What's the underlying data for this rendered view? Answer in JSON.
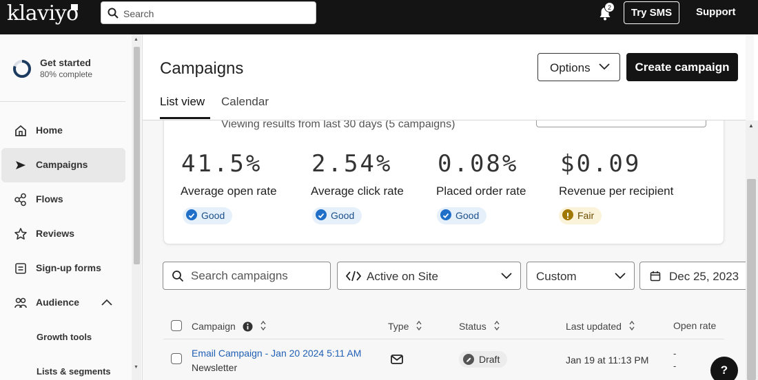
{
  "app": {
    "logo": "klaviyo"
  },
  "topbar": {
    "search_placeholder": "Search",
    "notification_count": "2",
    "try_sms": "Try SMS",
    "support": "Support"
  },
  "sidebar": {
    "get_started": {
      "title": "Get started",
      "progress_label": "80% complete",
      "progress": 0.8
    },
    "items": [
      {
        "label": "Home",
        "icon": "home-icon"
      },
      {
        "label": "Campaigns",
        "icon": "campaigns-icon",
        "active": true
      },
      {
        "label": "Flows",
        "icon": "flows-icon"
      },
      {
        "label": "Reviews",
        "icon": "star-icon"
      },
      {
        "label": "Sign-up forms",
        "icon": "form-icon"
      },
      {
        "label": "Audience",
        "icon": "audience-icon",
        "expanded": true
      }
    ],
    "sub_items": [
      {
        "label": "Growth tools"
      },
      {
        "label": "Lists & segments"
      }
    ]
  },
  "header": {
    "title": "Campaigns",
    "options_label": "Options",
    "create_label": "Create campaign",
    "tabs": [
      {
        "label": "List view",
        "active": true
      },
      {
        "label": "Calendar"
      }
    ]
  },
  "summary": {
    "viewing_text": "Viewing results from last 30 days (5 campaigns)",
    "metrics": [
      {
        "value": "41.5%",
        "label": "Average open rate",
        "rating": "Good"
      },
      {
        "value": "2.54%",
        "label": "Average click rate",
        "rating": "Good"
      },
      {
        "value": "0.08%",
        "label": "Placed order rate",
        "rating": "Good"
      },
      {
        "value": "$0.09",
        "label": "Revenue per recipient",
        "rating": "Fair"
      }
    ]
  },
  "filters": {
    "search_placeholder": "Search campaigns",
    "site_filter": "Active on Site",
    "range_filter": "Custom",
    "date": "Dec 25, 2023"
  },
  "table": {
    "columns": [
      "Campaign",
      "Type",
      "Status",
      "Last updated",
      "Open rate"
    ],
    "rows": [
      {
        "name": "Email Campaign - Jan 20 2024 5:11 AM",
        "subtitle": "Newsletter",
        "type_icon": "email-icon",
        "status": "Draft",
        "last_updated": "Jan 19 at 11:13 PM",
        "open_rate_1": "-",
        "open_rate_2": "-"
      }
    ]
  },
  "help": {
    "label": "?"
  },
  "colors": {
    "dark": "#141414",
    "link": "#1f5fb4",
    "good": "#1f6fc8",
    "fair": "#a07800"
  }
}
